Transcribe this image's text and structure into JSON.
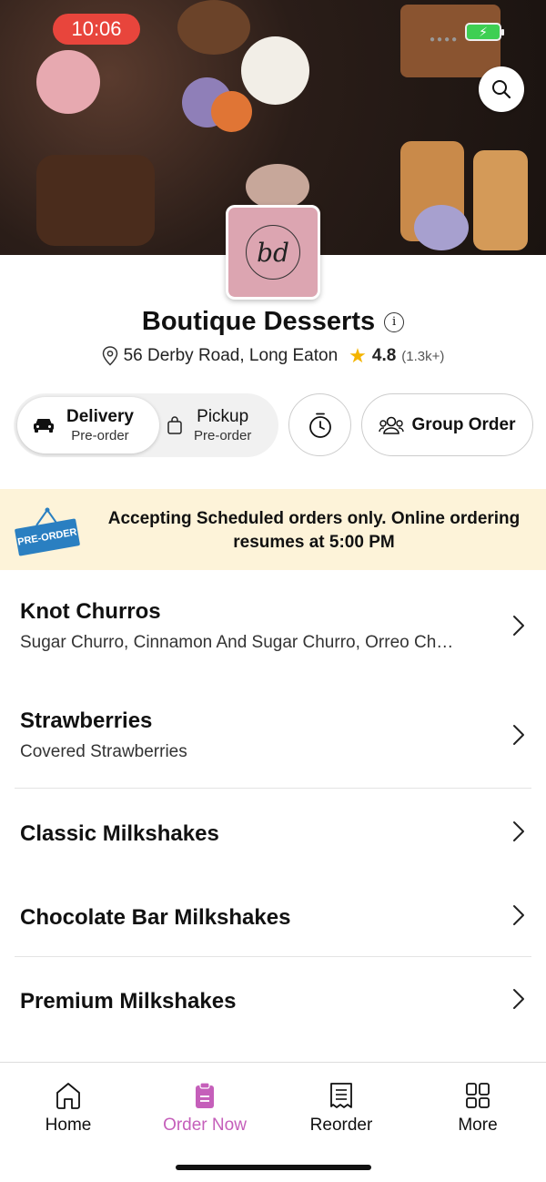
{
  "status_bar": {
    "time": "10:06",
    "battery_symbol": "⚡"
  },
  "store": {
    "name": "Boutique Desserts",
    "logo_initials": "bd",
    "address": "56 Derby Road, Long Eaton",
    "rating": "4.8",
    "rating_count": "(1.3k+)"
  },
  "order_mode": {
    "delivery": {
      "label": "Delivery",
      "sub": "Pre-order"
    },
    "pickup": {
      "label": "Pickup",
      "sub": "Pre-order"
    },
    "selected": "delivery"
  },
  "group_order_label": "Group Order",
  "banner": {
    "tag": "PRE-ORDER",
    "message": "Accepting Scheduled orders only. Online ordering resumes at 5:00 PM"
  },
  "menu": [
    {
      "title": "Knot Churros",
      "subtitle": "Sugar Churro, Cinnamon And Sugar Churro, Orreo Ch…"
    },
    {
      "title": "Strawberries",
      "subtitle": "Covered Strawberries"
    },
    {
      "title": "Classic Milkshakes",
      "subtitle": ""
    },
    {
      "title": "Chocolate Bar Milkshakes",
      "subtitle": ""
    },
    {
      "title": "Premium Milkshakes",
      "subtitle": ""
    }
  ],
  "tabs": [
    {
      "label": "Home",
      "icon": "home-icon"
    },
    {
      "label": "Order Now",
      "icon": "order-icon"
    },
    {
      "label": "Reorder",
      "icon": "receipt-icon"
    },
    {
      "label": "More",
      "icon": "grid-icon"
    }
  ],
  "colors": {
    "accent": "#c55fba",
    "banner_bg": "#fdf3d9",
    "star": "#f4b400",
    "status_pill": "#e8453c"
  }
}
